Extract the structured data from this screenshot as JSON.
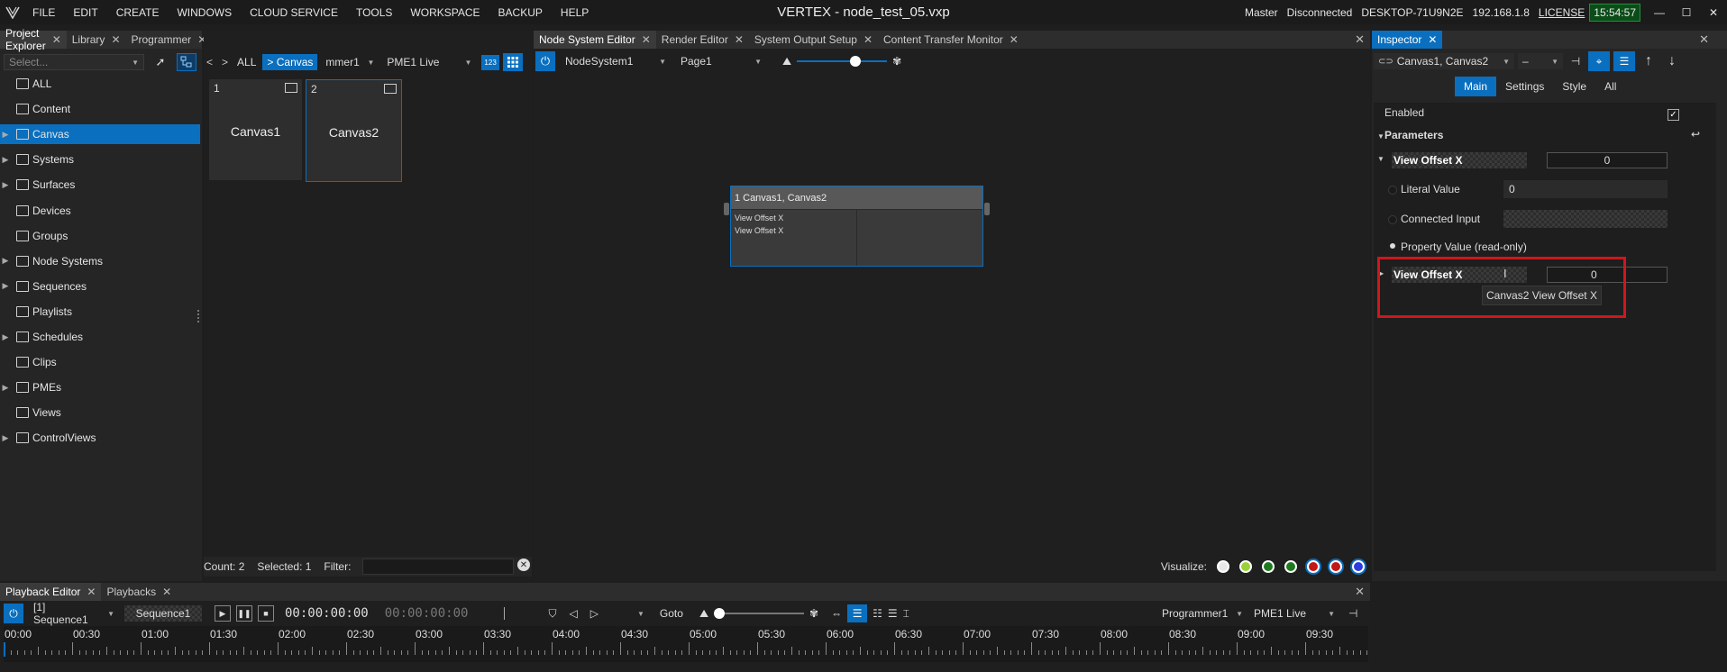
{
  "menu": [
    "FILE",
    "EDIT",
    "CREATE",
    "WINDOWS",
    "CLOUD SERVICE",
    "TOOLS",
    "WORKSPACE",
    "BACKUP",
    "HELP"
  ],
  "app_title": "VERTEX - node_test_05.vxp",
  "status": {
    "role": "Master",
    "connection": "Disconnected",
    "host": "DESKTOP-71U9N2E",
    "ip": "192.168.1.8",
    "license": "LICENSE",
    "clock": "15:54:57"
  },
  "window_buttons": {
    "minimize": "—",
    "maximize": "☐",
    "close": "✕"
  },
  "left_tabs": [
    "Project Explorer",
    "Library",
    "Programmer"
  ],
  "explorer": {
    "search_placeholder": "Select...",
    "items": [
      {
        "label": "ALL",
        "icon": "database-icon",
        "expandable": false
      },
      {
        "label": "Content",
        "icon": "content-icon",
        "expandable": false
      },
      {
        "label": "Canvas",
        "icon": "canvas-icon",
        "expandable": true,
        "selected": true
      },
      {
        "label": "Systems",
        "icon": "systems-icon",
        "expandable": true
      },
      {
        "label": "Surfaces",
        "icon": "surfaces-icon",
        "expandable": true
      },
      {
        "label": "Devices",
        "icon": "devices-icon",
        "expandable": false
      },
      {
        "label": "Groups",
        "icon": "groups-icon",
        "expandable": false
      },
      {
        "label": "Node Systems",
        "icon": "node-systems-icon",
        "expandable": true
      },
      {
        "label": "Sequences",
        "icon": "sequences-icon",
        "expandable": true
      },
      {
        "label": "Playlists",
        "icon": "playlists-icon",
        "expandable": false
      },
      {
        "label": "Schedules",
        "icon": "schedules-icon",
        "expandable": true
      },
      {
        "label": "Clips",
        "icon": "clips-icon",
        "expandable": false
      },
      {
        "label": "PMEs",
        "icon": "pmes-icon",
        "expandable": true
      },
      {
        "label": "Views",
        "icon": "views-icon",
        "expandable": false
      },
      {
        "label": "ControlViews",
        "icon": "controlviews-icon",
        "expandable": true
      }
    ]
  },
  "canvas_list": {
    "nav_back": "<",
    "nav_forward": ">",
    "crumb_all": "ALL",
    "crumb_canvas": "> Canvas",
    "programmer": "mmer1",
    "pme": "PME1 Live",
    "count_btn": "123",
    "tiles": [
      {
        "num": "1",
        "name": "Canvas1"
      },
      {
        "num": "2",
        "name": "Canvas2"
      }
    ],
    "footer": {
      "count": "Count: 2",
      "selected": "Selected: 1",
      "filter_label": "Filter:"
    }
  },
  "center_tabs": [
    "Node System Editor",
    "Render Editor",
    "System Output Setup",
    "Content Transfer Monitor"
  ],
  "node_editor": {
    "system": "NodeSystem1",
    "page": "Page1",
    "zoom": 0.65,
    "node": {
      "index": "1",
      "title": "Canvas1, Canvas2",
      "rows": [
        "View Offset X",
        "View Offset X"
      ]
    },
    "visualize_label": "Visualize:",
    "visualize_colors": [
      "#e8e8e8",
      "#9ad13a",
      "#1f7a1f",
      "#1f7a1f",
      "#c21818",
      "#c21818",
      "#2d3be0"
    ]
  },
  "inspector": {
    "tab": "Inspector",
    "selection": "Canvas1, Canvas2",
    "sub_tabs": [
      "Main",
      "Settings",
      "Style",
      "All"
    ],
    "enabled_label": "Enabled",
    "section": "Parameters",
    "param1": {
      "name": "View Offset X",
      "value": "0"
    },
    "literal_label": "Literal Value",
    "literal_value": "0",
    "connected_label": "Connected Input",
    "property_label": "Property Value (read-only)",
    "param2": {
      "name": "View Offset X",
      "value": "0"
    },
    "tooltip": "Canvas2 View Offset X"
  },
  "bottom_tabs": [
    "Playback Editor",
    "Playbacks"
  ],
  "playback": {
    "sequence": "[1] Sequence1",
    "sequence_name": "Sequence1",
    "timecode": "00:00:00:00",
    "timecode2": "00:00:00:00",
    "goto": "Goto",
    "programmer": "Programmer1",
    "pme": "PME1 Live",
    "ruler": [
      "00:00",
      "00:30",
      "01:00",
      "01:30",
      "02:00",
      "02:30",
      "03:00",
      "03:30",
      "04:00",
      "04:30",
      "05:00",
      "05:30",
      "06:00",
      "06:30",
      "07:00",
      "07:30",
      "08:00",
      "08:30",
      "09:00",
      "09:30"
    ]
  }
}
